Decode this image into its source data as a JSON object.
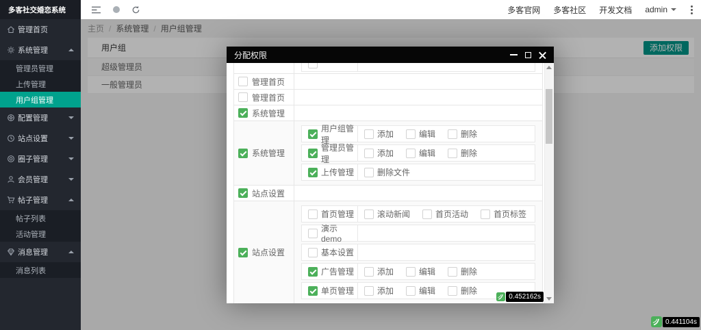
{
  "app_title": "多客社交婚恋系统",
  "topbar": {
    "links": [
      "多客官网",
      "多客社区",
      "开发文档"
    ],
    "user": "admin"
  },
  "breadcrumb": {
    "items": [
      "主页",
      "系统管理",
      "用户组管理"
    ],
    "separator": "/"
  },
  "sidebar": {
    "items": [
      {
        "label": "管理首页",
        "icon": "home-icon"
      },
      {
        "label": "系统管理",
        "icon": "gear-icon",
        "expanded": true,
        "children": [
          {
            "label": "管理员管理"
          },
          {
            "label": "上传管理"
          },
          {
            "label": "用户组管理",
            "active": true
          }
        ]
      },
      {
        "label": "配置管理",
        "icon": "config-icon",
        "expanded": false
      },
      {
        "label": "站点设置",
        "icon": "site-icon",
        "expanded": false
      },
      {
        "label": "圈子管理",
        "icon": "circle-icon",
        "expanded": false
      },
      {
        "label": "会员管理",
        "icon": "member-icon",
        "expanded": false
      },
      {
        "label": "帖子管理",
        "icon": "posts-icon",
        "expanded": true,
        "children": [
          {
            "label": "帖子列表"
          },
          {
            "label": "活动管理"
          }
        ]
      },
      {
        "label": "消息管理",
        "icon": "message-icon",
        "expanded": true,
        "children": [
          {
            "label": "消息列表"
          }
        ]
      }
    ]
  },
  "page": {
    "table": {
      "header": "用户组",
      "rows": [
        "超级管理员",
        "一般管理员"
      ]
    },
    "add_button": "添加权限",
    "load_time": "0.441104s"
  },
  "modal": {
    "title": "分配权限",
    "load_time": "0.452162s",
    "permissions": [
      {
        "partial": true
      },
      {
        "label": "管理首页",
        "checked": false
      },
      {
        "label": "管理首页",
        "checked": false
      },
      {
        "label": "系统管理",
        "checked": true
      },
      {
        "label": "系统管理",
        "checked": true,
        "children": [
          {
            "label": "用户组管理",
            "checked": true,
            "actions": [
              {
                "label": "添加",
                "checked": false
              },
              {
                "label": "编辑",
                "checked": false
              },
              {
                "label": "删除",
                "checked": false
              }
            ]
          },
          {
            "label": "管理员管理",
            "checked": true,
            "actions": [
              {
                "label": "添加",
                "checked": false
              },
              {
                "label": "编辑",
                "checked": false
              },
              {
                "label": "删除",
                "checked": false
              }
            ]
          },
          {
            "label": "上传管理",
            "checked": true,
            "actions": [
              {
                "label": "删除文件",
                "checked": false
              }
            ]
          }
        ]
      },
      {
        "label": "站点设置",
        "checked": true
      },
      {
        "label": "站点设置",
        "checked": true,
        "children": [
          {
            "label": "首页管理",
            "checked": false,
            "actions": [
              {
                "label": "滚动新闻",
                "checked": false
              },
              {
                "label": "首页活动",
                "checked": false
              },
              {
                "label": "首页标签",
                "checked": false
              }
            ]
          },
          {
            "label": "演示demo",
            "checked": false,
            "actions": []
          },
          {
            "label": "基本设置",
            "checked": false,
            "actions": []
          },
          {
            "label": "广告管理",
            "checked": true,
            "actions": [
              {
                "label": "添加",
                "checked": false
              },
              {
                "label": "编辑",
                "checked": false
              },
              {
                "label": "删除",
                "checked": false
              }
            ]
          },
          {
            "label": "单页管理",
            "checked": true,
            "actions": [
              {
                "label": "添加",
                "checked": false
              },
              {
                "label": "编辑",
                "checked": false
              },
              {
                "label": "删除",
                "checked": false
              }
            ]
          }
        ]
      }
    ]
  },
  "colors": {
    "accent_teal": "#009688",
    "sidebar_active": "#00a28d",
    "checkbox_green": "#4cb05a",
    "badge_green": "#4cb05a",
    "modal_titlebar": "#060606"
  }
}
